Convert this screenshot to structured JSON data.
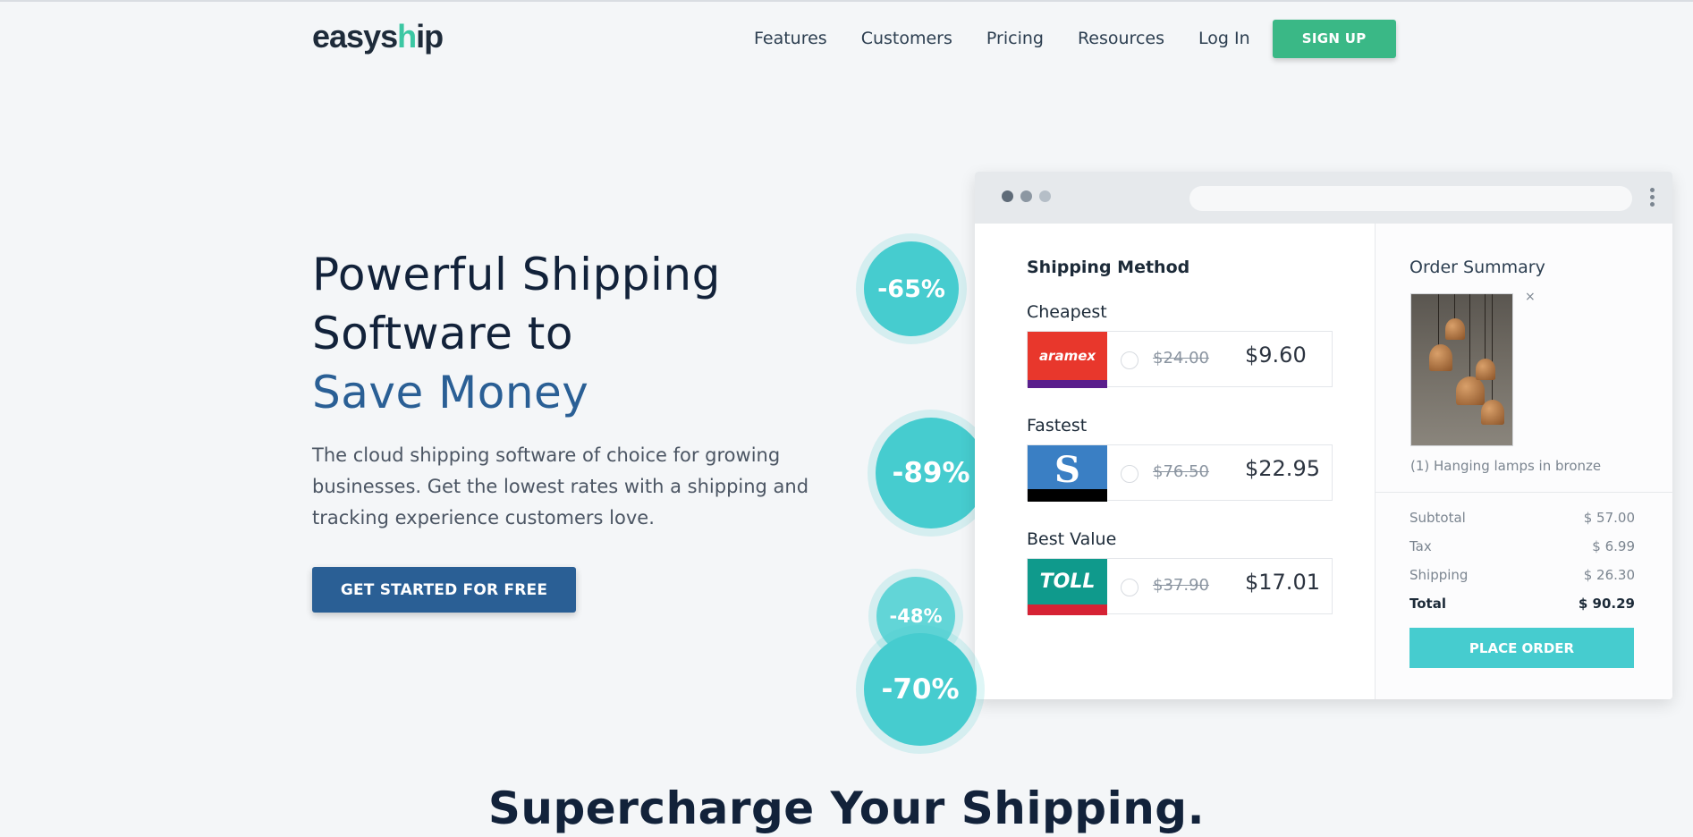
{
  "brand": {
    "name_part1": "easys",
    "name_part2": "h",
    "name_part3": "ip"
  },
  "nav": {
    "items": [
      "Features",
      "Customers",
      "Pricing",
      "Resources",
      "Log In"
    ],
    "signup_label": "SIGN UP"
  },
  "hero": {
    "title_line1": "Powerful Shipping",
    "title_line2": "Software to",
    "title_highlight": "Save Money",
    "subtitle": "The cloud shipping software of choice for growing businesses. Get the lowest rates with a shipping and tracking experience customers love.",
    "cta_label": "GET STARTED FOR FREE"
  },
  "discounts": [
    "-65%",
    "-89%",
    "-48%",
    "-70%"
  ],
  "shipping": {
    "title": "Shipping Method",
    "options": [
      {
        "label": "Cheapest",
        "carrier": "aramex",
        "old_price": "$24.00",
        "new_price": "$9.60",
        "color": "#e8372c",
        "strip": "#5a1e8c"
      },
      {
        "label": "Fastest",
        "carrier": "S",
        "old_price": "$76.50",
        "new_price": "$22.95",
        "color": "#3a7fc4",
        "strip": "#000000"
      },
      {
        "label": "Best Value",
        "carrier": "TOLL",
        "old_price": "$37.90",
        "new_price": "$17.01",
        "color": "#0f9a8c",
        "strip": "#d62234"
      }
    ]
  },
  "order": {
    "title": "Order Summary",
    "close": "×",
    "item_caption": "(1) Hanging lamps in bronze",
    "rows": [
      {
        "label": "Subtotal",
        "value": "$ 57.00"
      },
      {
        "label": "Tax",
        "value": "$ 6.99"
      },
      {
        "label": "Shipping",
        "value": "$ 26.30"
      },
      {
        "label": "Total",
        "value": "$ 90.29"
      }
    ],
    "place_label": "PLACE ORDER"
  },
  "section": {
    "title": "Supercharge Your Shipping."
  },
  "colors": {
    "accent_green": "#3ab886",
    "accent_blue": "#2a5f95",
    "accent_teal": "#46cccf"
  }
}
